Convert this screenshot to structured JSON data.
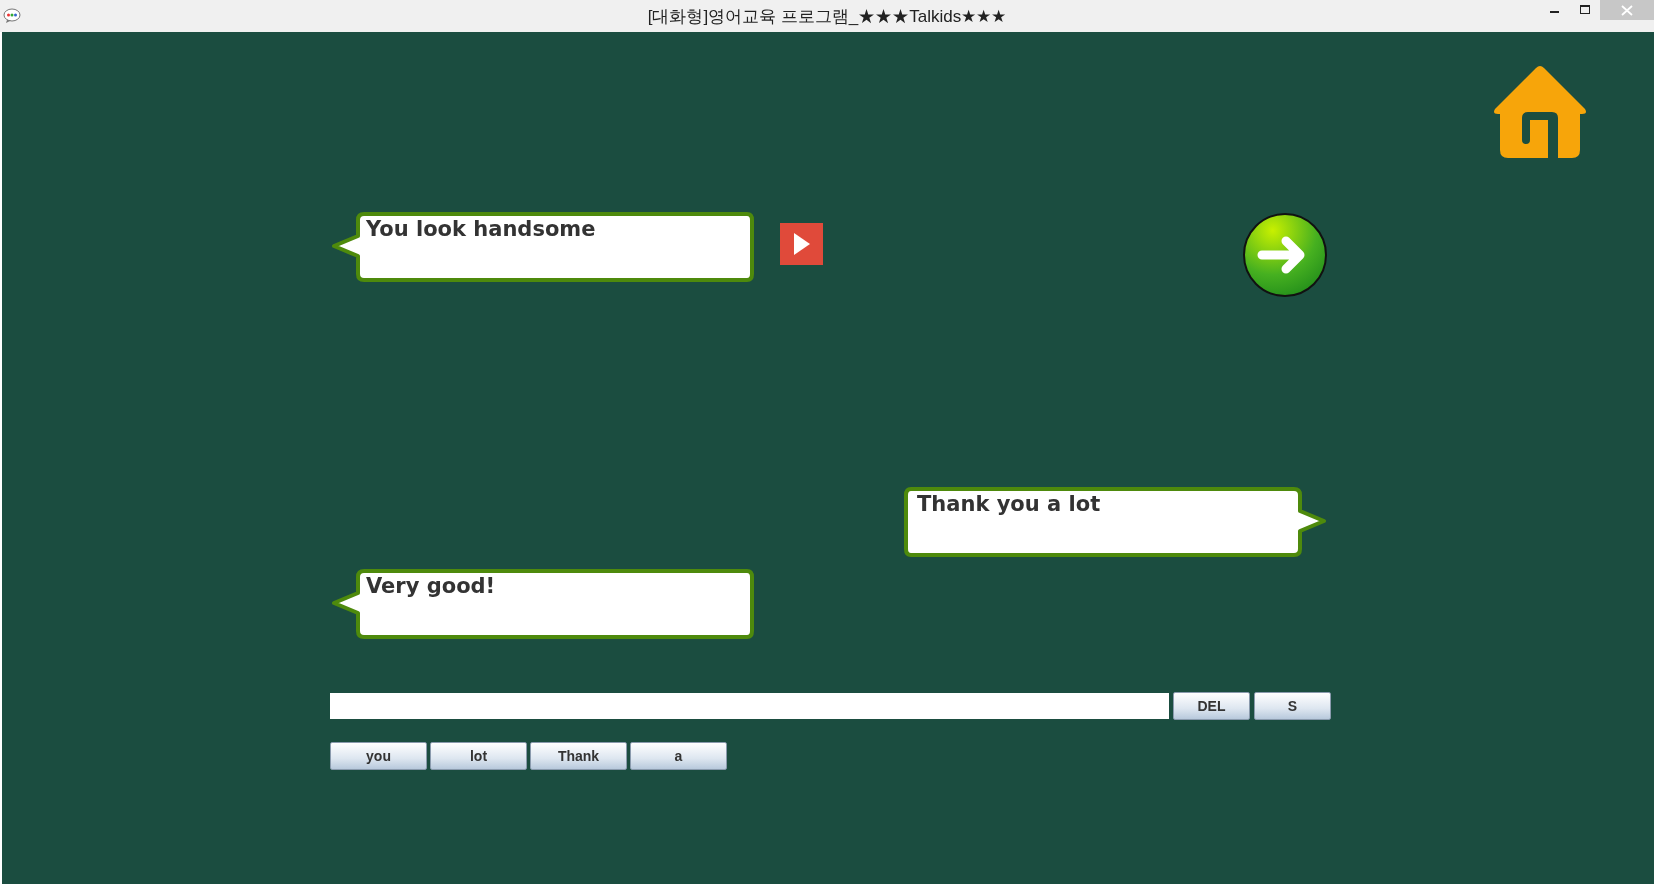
{
  "window": {
    "title": "[대화형]영어교육 프로그램_★★★Talkids★★★"
  },
  "bubbles": [
    {
      "text": "You look handsome",
      "kind": "left"
    },
    {
      "text": "Thank you a lot",
      "kind": "right"
    },
    {
      "text": "Very good!",
      "kind": "left"
    }
  ],
  "answer_buttons": [
    "DEL",
    "S"
  ],
  "word_buttons": [
    "you",
    "lot",
    "Thank",
    "a"
  ]
}
